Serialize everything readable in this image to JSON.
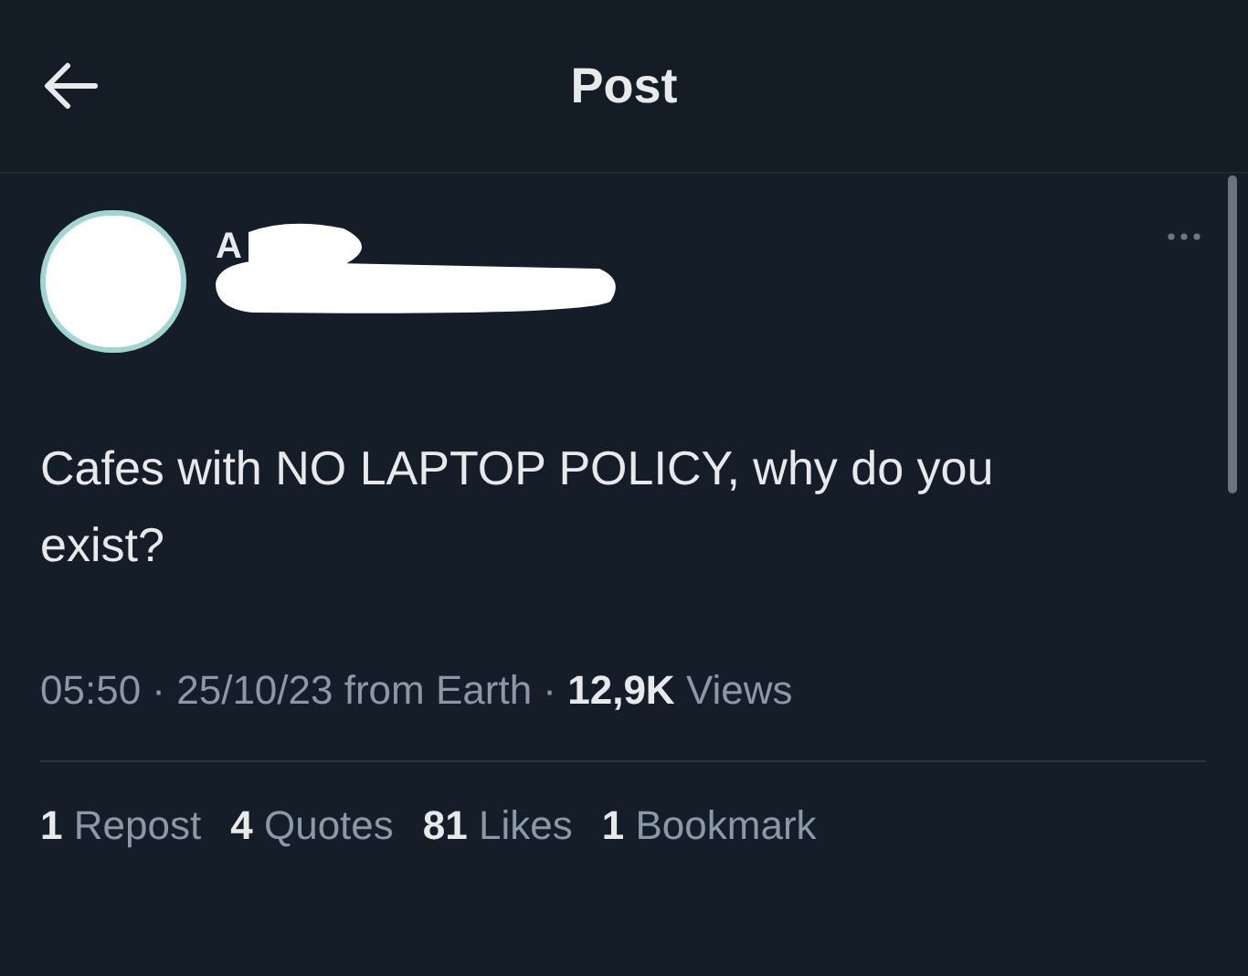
{
  "header": {
    "title": "Post"
  },
  "post": {
    "author_visible": "A",
    "text": "Cafes with NO LAPTOP POLICY, why do you exist?",
    "meta": "05:50 · 25/10/23 from Earth · **12,9K** Views",
    "stats": [
      {
        "count": "1",
        "label": "Repost"
      },
      {
        "count": "4",
        "label": "Quotes"
      },
      {
        "count": "81",
        "label": "Likes"
      },
      {
        "count": "1",
        "label": "Bookmark"
      }
    ]
  }
}
